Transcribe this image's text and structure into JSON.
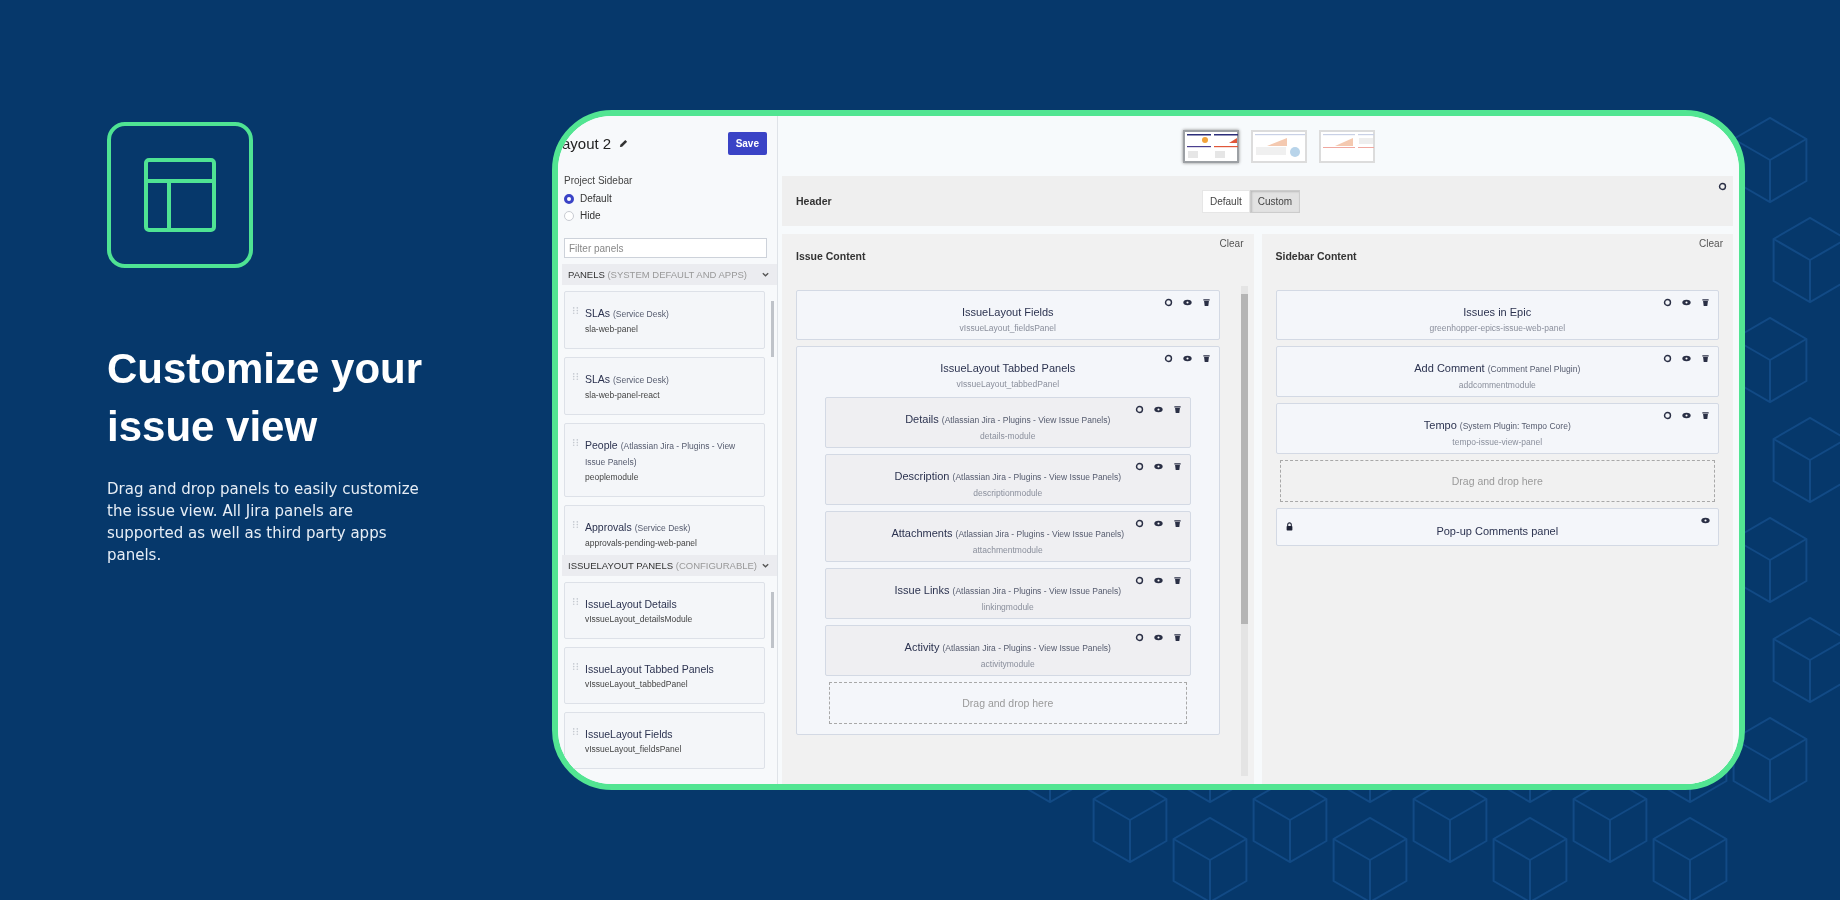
{
  "promo": {
    "heading": "Customize your issue view",
    "description": "Drag and drop panels to easily customize the issue view. All Jira panels are supported as well as third party apps panels."
  },
  "app": {
    "sidebar": {
      "title": "ayout 2",
      "save": "Save",
      "project_sidebar": {
        "label": "Project Sidebar",
        "options": [
          {
            "label": "Default",
            "selected": true
          },
          {
            "label": "Hide",
            "selected": false
          }
        ]
      },
      "filter_placeholder": "Filter panels",
      "groups": [
        {
          "title": "PANELS",
          "note": "(SYSTEM DEFAULT AND APPS)",
          "expanded": true,
          "panels": [
            {
              "name": "SLAs",
              "source": "(Service Desk)",
              "key": "sla-web-panel"
            },
            {
              "name": "SLAs",
              "source": "(Service Desk)",
              "key": "sla-web-panel-react"
            },
            {
              "name": "People",
              "source": "(Atlassian Jira - Plugins - View Issue Panels)",
              "key": "peoplemodule"
            },
            {
              "name": "Approvals",
              "source": "(Service Desk)",
              "key": "approvals-pending-web-panel"
            }
          ]
        },
        {
          "title": "ISSUELAYOUT PANELS",
          "note": "(CONFIGURABLE)",
          "expanded": true,
          "panels": [
            {
              "name": "IssueLayout Details",
              "key": "vIssueLayout_detailsModule"
            },
            {
              "name": "IssueLayout Tabbed Panels",
              "key": "vIssueLayout_tabbedPanel"
            },
            {
              "name": "IssueLayout Fields",
              "key": "vIssueLayout_fieldsPanel"
            }
          ]
        }
      ]
    },
    "layouts": [
      {
        "kind": "split",
        "selected": true
      },
      {
        "kind": "wide",
        "selected": false
      },
      {
        "kind": "chart_sidebar",
        "selected": false
      }
    ],
    "header": {
      "label": "Header",
      "modes": [
        {
          "label": "Default",
          "selected": false
        },
        {
          "label": "Custom",
          "selected": true
        }
      ]
    },
    "columns": [
      {
        "title": "Issue Content",
        "clear": "Clear",
        "panels": [
          {
            "kind": "panel",
            "name": "IssueLayout Fields",
            "key": "vIssueLayout_fieldsPanel"
          },
          {
            "kind": "panel",
            "name": "IssueLayout Tabbed Panels",
            "key": "vIssueLayout_tabbedPanel",
            "children": [
              {
                "kind": "panel",
                "name": "Details",
                "source": "(Atlassian Jira - Plugins - View Issue Panels)",
                "key": "details-module"
              },
              {
                "kind": "panel",
                "name": "Description",
                "source": "(Atlassian Jira - Plugins - View Issue Panels)",
                "key": "descriptionmodule"
              },
              {
                "kind": "panel",
                "name": "Attachments",
                "source": "(Atlassian Jira - Plugins - View Issue Panels)",
                "key": "attachmentmodule"
              },
              {
                "kind": "panel",
                "name": "Issue Links",
                "source": "(Atlassian Jira - Plugins - View Issue Panels)",
                "key": "linkingmodule"
              },
              {
                "kind": "panel",
                "name": "Activity",
                "source": "(Atlassian Jira - Plugins - View Issue Panels)",
                "key": "activitymodule"
              },
              {
                "kind": "drop_zone",
                "label": "Drag and drop here"
              }
            ]
          }
        ]
      },
      {
        "title": "Sidebar Content",
        "clear": "Clear",
        "panels": [
          {
            "kind": "panel",
            "name": "Issues in Epic",
            "key": "greenhopper-epics-issue-web-panel"
          },
          {
            "kind": "panel",
            "name": "Add Comment",
            "source": "(Comment Panel Plugin)",
            "key": "addcommentmodule"
          },
          {
            "kind": "panel",
            "name": "Tempo",
            "source": "(System Plugin: Tempo Core)",
            "key": "tempo-issue-view-panel"
          },
          {
            "kind": "drop_zone",
            "label": "Drag and drop here"
          },
          {
            "kind": "locked",
            "name": "Pop-up Comments panel"
          }
        ]
      }
    ]
  }
}
